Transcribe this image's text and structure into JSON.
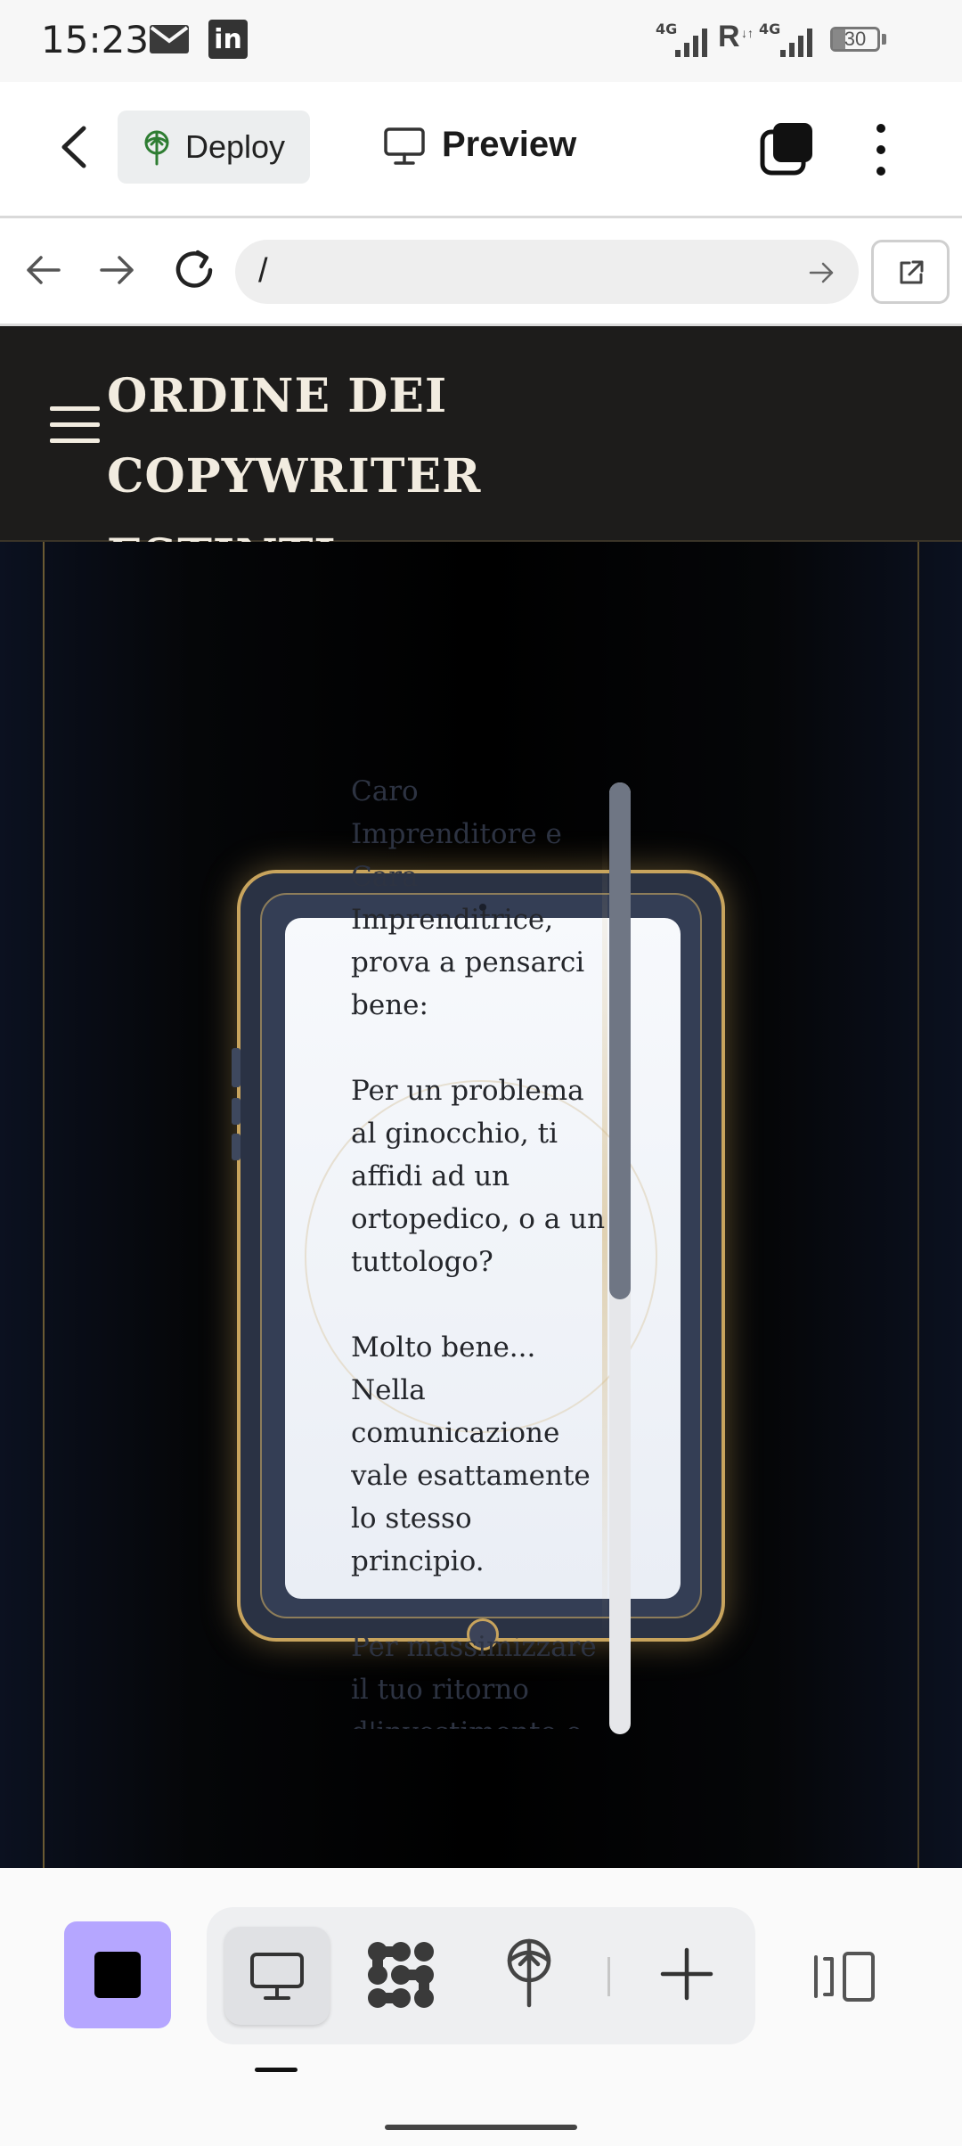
{
  "status_bar": {
    "time": "15:23",
    "network_1": "4G",
    "roaming": "R",
    "network_2": "4G",
    "battery": "30",
    "icons": [
      "mail-icon",
      "linkedin-icon",
      "signal-icon",
      "battery-icon"
    ]
  },
  "app_bar": {
    "deploy_label": "Deploy",
    "preview_label": "Preview",
    "icons": [
      "back-arrow-icon",
      "deploy-icon",
      "monitor-icon",
      "tabs-icon",
      "more-vertical-icon"
    ]
  },
  "browser": {
    "url": "/",
    "icons": [
      "nav-back-icon",
      "nav-forward-icon",
      "reload-icon",
      "go-arrow-icon",
      "open-external-icon"
    ]
  },
  "site": {
    "title_line1": "ORDINE DEI COPYWRITER",
    "title_line2": "ESTINTI",
    "colors": {
      "header_bg": "#1d1c1b",
      "gold": "#c8a45d"
    }
  },
  "letter": {
    "lines": [
      "Caro",
      "Imprenditore e",
      "Cara",
      "Imprenditrice,",
      "prova a pensarci",
      "bene:",
      "",
      "Per un problema",
      "al ginocchio, ti",
      "affidi ad un",
      "ortopedico, o a un",
      "tuttologo?",
      "",
      "Molto bene...",
      "Nella",
      "comunicazione",
      "vale esattamente",
      "lo stesso principio.",
      "",
      "Per massimizzare",
      "il tuo ritorno",
      "d'investimento e"
    ]
  },
  "bottom_bar": {
    "accent": "#b5a6ff",
    "icons": [
      "stop-icon",
      "desktop-icon",
      "nodes-icon",
      "deploy-icon",
      "add-icon",
      "layout-icon"
    ]
  }
}
